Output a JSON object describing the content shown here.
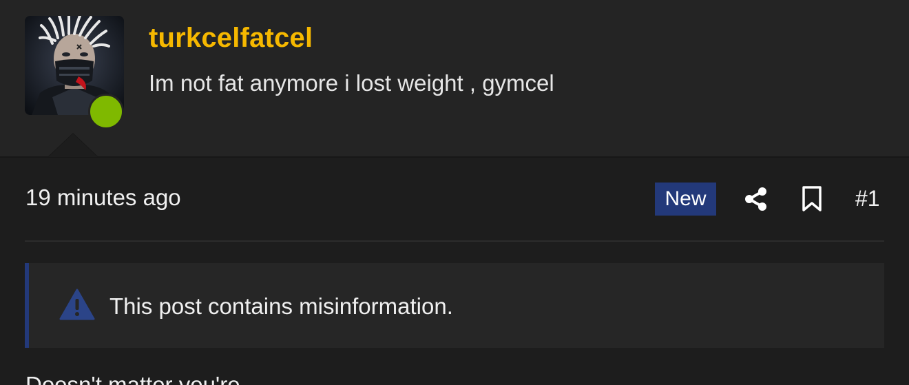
{
  "user": {
    "name": "turkcelfatcel",
    "title": "Im not fat anymore i lost weight , gymcel",
    "online": true
  },
  "post": {
    "timestamp": "19 minutes ago",
    "badge": "New",
    "number": "#1",
    "share_icon": "share-icon",
    "bookmark_icon": "bookmark-icon"
  },
  "notice": {
    "icon": "warning-icon",
    "text": "This post contains misinformation."
  },
  "body": {
    "first_line": "Doesn't matter you're"
  },
  "colors": {
    "username": "#f6b800",
    "online": "#7fb900",
    "badge_bg": "#23397a",
    "notice_accent": "#23397a"
  }
}
